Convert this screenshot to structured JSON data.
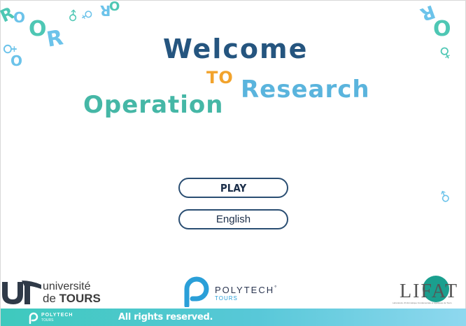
{
  "title": {
    "line1": "Welcome",
    "line2_to": "TO",
    "line2_research": "Research",
    "line3": "Operation"
  },
  "menu": {
    "play_label": "PLAY",
    "language_label": "English"
  },
  "logos": {
    "universite_line1": "université",
    "universite_line2_prefix": "de ",
    "universite_line2_bold": "TOURS",
    "polytech_name": "POLYTECH",
    "polytech_mark": "°",
    "polytech_sub": "TOURS",
    "lifat_letters": "LIFAT",
    "lifat_caption": "Laboratoire d'Informatique Fondamentale et Appliquée de Tours"
  },
  "footer": {
    "logo_name": "POLYTECH",
    "logo_sub": "TOURS",
    "rights": "All rights reserved."
  },
  "decorations": {
    "symbol_r": "R",
    "symbol_o": "O",
    "symbol_male": "♂",
    "symbol_female": "♀"
  },
  "colors": {
    "title_navy": "#25557f",
    "title_orange": "#f2a32c",
    "title_blue": "#5ab4dd",
    "title_teal": "#45b7a6",
    "button_border": "#2a4e72",
    "footer_start": "#3ec9bd",
    "footer_end": "#8fd8ef"
  }
}
